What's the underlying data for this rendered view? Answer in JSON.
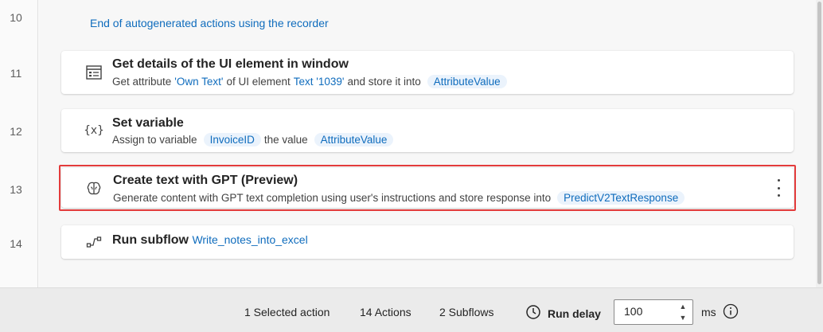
{
  "gutter": {
    "lines": [
      "10",
      "11",
      "12",
      "13",
      "14"
    ]
  },
  "comment": {
    "text": "End of autogenerated actions using the recorder"
  },
  "actions": [
    {
      "title": "Get details of the UI element in window",
      "icon": "ui-element-details-icon",
      "desc_prefix": "Get attribute",
      "attr": "'Own Text'",
      "desc_mid": "of UI element",
      "element": "Text '1039'",
      "desc_suffix": "and store it into",
      "var": "AttributeValue"
    },
    {
      "title": "Set variable",
      "icon": "variable-braces-icon",
      "icon_text": "{x}",
      "desc_prefix": "Assign to variable",
      "var1": "InvoiceID",
      "desc_mid": "the value",
      "var2": "AttributeValue"
    },
    {
      "title": "Create text with GPT (Preview)",
      "icon": "brain-icon",
      "desc": "Generate content with GPT text completion using user's instructions and store response into",
      "var": "PredictV2TextResponse",
      "selected": true
    },
    {
      "title": "Run subflow",
      "icon": "subflow-icon",
      "subflow": "Write_notes_into_excel"
    }
  ],
  "status_bar": {
    "selected": "1 Selected action",
    "actions": "14 Actions",
    "subflows": "2 Subflows",
    "run_delay_label": "Run delay",
    "run_delay_value": "100",
    "unit": "ms"
  },
  "colors": {
    "accent": "#0f6cbd",
    "chip_bg": "#ebf3fc",
    "selection_border": "#e33b3b"
  }
}
